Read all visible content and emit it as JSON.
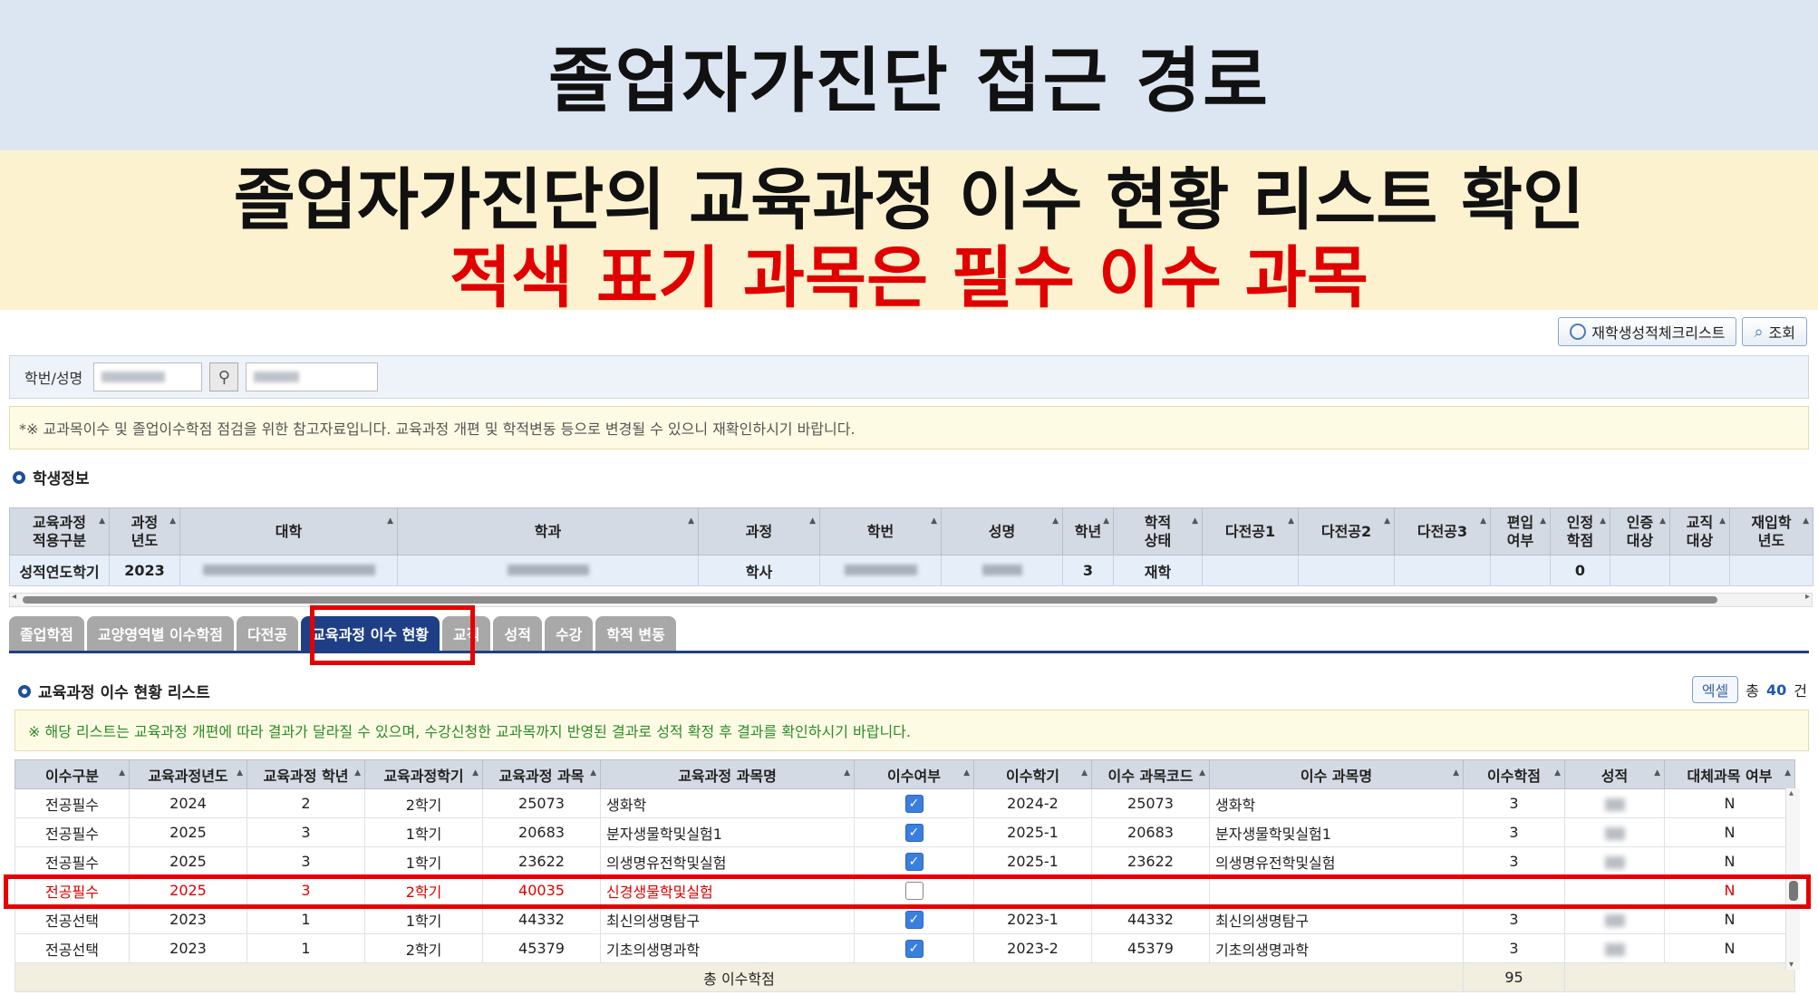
{
  "banner": {
    "title": "졸업자가진단 접근 경로",
    "subtitle1": "졸업자가진단의 교육과정 이수 현황 리스트 확인",
    "subtitle2": "적색 표기 과목은 필수 이수 과목"
  },
  "toolbar": {
    "checklist_label": "재학생성적체크리스트",
    "search_label": "조회"
  },
  "search": {
    "label": "학번/성명"
  },
  "notice1": "*※ 교과목이수 및 졸업이수학점 점검을 위한 참고자료입니다. 교육과정 개편 및 학적변동 등으로 변경될 수 있으니 재확인하시기 바랍니다.",
  "student": {
    "section_title": "학생정보",
    "headers": [
      "교육과정\n적용구분",
      "과정\n년도",
      "대학",
      "학과",
      "과정",
      "학번",
      "성명",
      "학년",
      "학적\n상태",
      "다전공1",
      "다전공2",
      "다전공3",
      "편입\n여부",
      "인정\n학점",
      "인증\n대상",
      "교직\n대상",
      "재입학\n년도"
    ],
    "row": {
      "type": "성적연도학기",
      "year": "2023",
      "course": "학사",
      "grade": "3",
      "status": "재학",
      "credit": "0"
    }
  },
  "tabs": [
    "졸업학점",
    "교양영역별 이수학점",
    "다전공",
    "교육과정 이수 현황",
    "교직",
    "성적",
    "수강",
    "학적 변동"
  ],
  "active_tab_index": 3,
  "list": {
    "section_title": "교육과정 이수 현황 리스트",
    "excel_label": "엑셀",
    "total_prefix": "총",
    "total_count": "40",
    "total_suffix": "건",
    "notice": "※ 해당 리스트는 교육과정 개편에 따라 결과가 달라질 수 있으며, 수강신청한 교과목까지 반영된 결과로 성적 확정 후 결과를 확인하시기 바랍니다.",
    "headers": [
      "이수구분",
      "교육과정년도",
      "교육과정 학년",
      "교육과정학기",
      "교육과정 과목",
      "교육과정 과목명",
      "이수여부",
      "이수학기",
      "이수 과목코드",
      "이수 과목명",
      "이수학점",
      "성적",
      "대체과목 여부"
    ],
    "rows": [
      {
        "div": "전공필수",
        "cyear": "2024",
        "cgrade": "2",
        "csem": "2학기",
        "code": "25073",
        "name": "생화학",
        "done": true,
        "tsem": "2024-2",
        "tcode": "25073",
        "tname": "생화학",
        "credit": "3",
        "sub": "N",
        "required": false
      },
      {
        "div": "전공필수",
        "cyear": "2025",
        "cgrade": "3",
        "csem": "1학기",
        "code": "20683",
        "name": "분자생물학및실험1",
        "done": true,
        "tsem": "2025-1",
        "tcode": "20683",
        "tname": "분자생물학및실험1",
        "credit": "3",
        "sub": "N",
        "required": false
      },
      {
        "div": "전공필수",
        "cyear": "2025",
        "cgrade": "3",
        "csem": "1학기",
        "code": "23622",
        "name": "의생명유전학및실험",
        "done": true,
        "tsem": "2025-1",
        "tcode": "23622",
        "tname": "의생명유전학및실험",
        "credit": "3",
        "sub": "N",
        "required": false
      },
      {
        "div": "전공필수",
        "cyear": "2025",
        "cgrade": "3",
        "csem": "2학기",
        "code": "40035",
        "name": "신경생물학및실험",
        "done": false,
        "tsem": "",
        "tcode": "",
        "tname": "",
        "credit": "",
        "sub": "N",
        "required": true
      },
      {
        "div": "전공선택",
        "cyear": "2023",
        "cgrade": "1",
        "csem": "1학기",
        "code": "44332",
        "name": "최신의생명탐구",
        "done": true,
        "tsem": "2023-1",
        "tcode": "44332",
        "tname": "최신의생명탐구",
        "credit": "3",
        "sub": "N",
        "required": false
      },
      {
        "div": "전공선택",
        "cyear": "2023",
        "cgrade": "1",
        "csem": "2학기",
        "code": "45379",
        "name": "기초의생명과학",
        "done": true,
        "tsem": "2023-2",
        "tcode": "45379",
        "tname": "기초의생명과학",
        "credit": "3",
        "sub": "N",
        "required": false
      }
    ],
    "total_label": "총 이수학점",
    "total_credit": "95"
  },
  "colors": {
    "accent": "#1e3f86",
    "highlight": "#e60000",
    "banner_top": "#dce6f2",
    "banner_bottom": "#fdf2d0"
  }
}
